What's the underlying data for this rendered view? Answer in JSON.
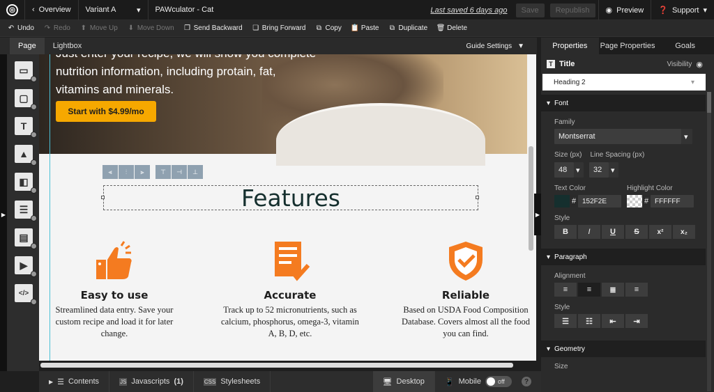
{
  "topbar": {
    "back_label": "Overview",
    "variant_label": "Variant A",
    "page_title": "PAWculator - Cat",
    "last_saved": "Last saved 6 days ago",
    "save_label": "Save",
    "republish_label": "Republish",
    "preview_label": "Preview",
    "support_label": "Support"
  },
  "toolbar": {
    "undo": "Undo",
    "redo": "Redo",
    "move_up": "Move Up",
    "move_down": "Move Down",
    "send_backward": "Send Backward",
    "bring_forward": "Bring Forward",
    "copy": "Copy",
    "paste": "Paste",
    "duplicate": "Duplicate",
    "delete": "Delete"
  },
  "editor_tabs": {
    "page": "Page",
    "lightbox": "Lightbox",
    "guide_settings": "Guide Settings"
  },
  "canvas": {
    "hero_text": "Just enter your recipe, we will show you complete nutrition information, including protain, fat, vitamins and minerals.",
    "cta_label": "Start with $4.99/mo",
    "features_title": "Features",
    "features": [
      {
        "title": "Easy to use",
        "text": "Streamlined data entry. Save your custom recipe and load it for later change.",
        "icon": "thumbs-up-icon"
      },
      {
        "title": "Accurate",
        "text": "Track up to 52 micronutrients, such as calcium, phosphorus, omega-3, vitamin A, B, D, etc.",
        "icon": "document-check-icon"
      },
      {
        "title": "Reliable",
        "text": "Based on USDA Food Composition Database. Covers almost all the food you can find.",
        "icon": "shield-check-icon"
      }
    ],
    "accent": "#F6A800",
    "icon_color": "#F47B20"
  },
  "bottombar": {
    "contents": "Contents",
    "javascripts": "Javascripts",
    "js_count": "(1)",
    "stylesheets": "Stylesheets",
    "desktop": "Desktop",
    "mobile": "Mobile",
    "toggle": "off",
    "help": "?"
  },
  "panel": {
    "tabs": [
      "Properties",
      "Page Properties",
      "Goals"
    ],
    "element_name": "Title",
    "visibility": "Visibility",
    "heading_select": "Heading 2",
    "font_section": "Font",
    "family_label": "Family",
    "family_value": "Montserrat",
    "size_label": "Size (px)",
    "size_value": "48",
    "line_spacing_label": "Line Spacing (px)",
    "line_spacing_value": "32",
    "text_color_label": "Text Color",
    "text_color_value": "152F2E",
    "highlight_label": "Highlight Color",
    "highlight_value": "FFFFFF",
    "style_label": "Style",
    "style_buttons": [
      "B",
      "I",
      "U",
      "S",
      "x²",
      "x₂"
    ],
    "paragraph_section": "Paragraph",
    "alignment_label": "Alignment",
    "pstyle_label": "Style",
    "geometry_section": "Geometry",
    "geometry_size": "Size"
  }
}
